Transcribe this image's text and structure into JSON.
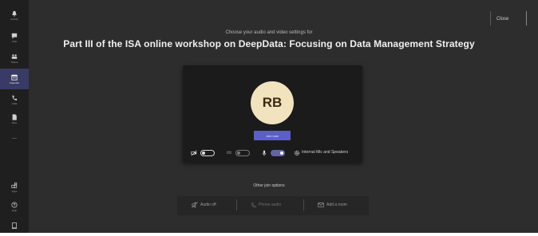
{
  "sidebar": {
    "items": [
      {
        "label": "Activity",
        "icon": "bell-icon"
      },
      {
        "label": "Chat",
        "icon": "chat-icon"
      },
      {
        "label": "Teams",
        "icon": "teams-icon"
      },
      {
        "label": "Calendar",
        "icon": "calendar-icon",
        "active": true
      },
      {
        "label": "Calls",
        "icon": "phone-icon"
      },
      {
        "label": "Files",
        "icon": "file-icon"
      },
      {
        "label": "...",
        "icon": "more-icon"
      }
    ],
    "bottom_items": [
      {
        "label": "Apps",
        "icon": "apps-icon"
      },
      {
        "label": "Help",
        "icon": "help-icon"
      },
      {
        "label": "",
        "icon": "device-icon"
      }
    ]
  },
  "header": {
    "close_label": "Close"
  },
  "prejoin": {
    "prompt": "Choose your audio and video settings for",
    "meeting_title": "Part III of the ISA online workshop on DeepData: Focusing on Data Management Strategy",
    "avatar_initials": "RB",
    "join_label": "Join now",
    "device_label": "Internal Mic and Speakers"
  },
  "other_join": {
    "heading": "Other join options",
    "options": [
      {
        "label": "Audio off",
        "icon": "speaker-off-icon"
      },
      {
        "label": "Phone audio",
        "icon": "phone-icon"
      },
      {
        "label": "Add a room",
        "icon": "room-icon"
      }
    ]
  },
  "colors": {
    "accent": "#5b5fc7",
    "avatar_bg": "#f2e3bf",
    "background": "#2d2d2d",
    "sidebar": "#1f1f1f"
  }
}
